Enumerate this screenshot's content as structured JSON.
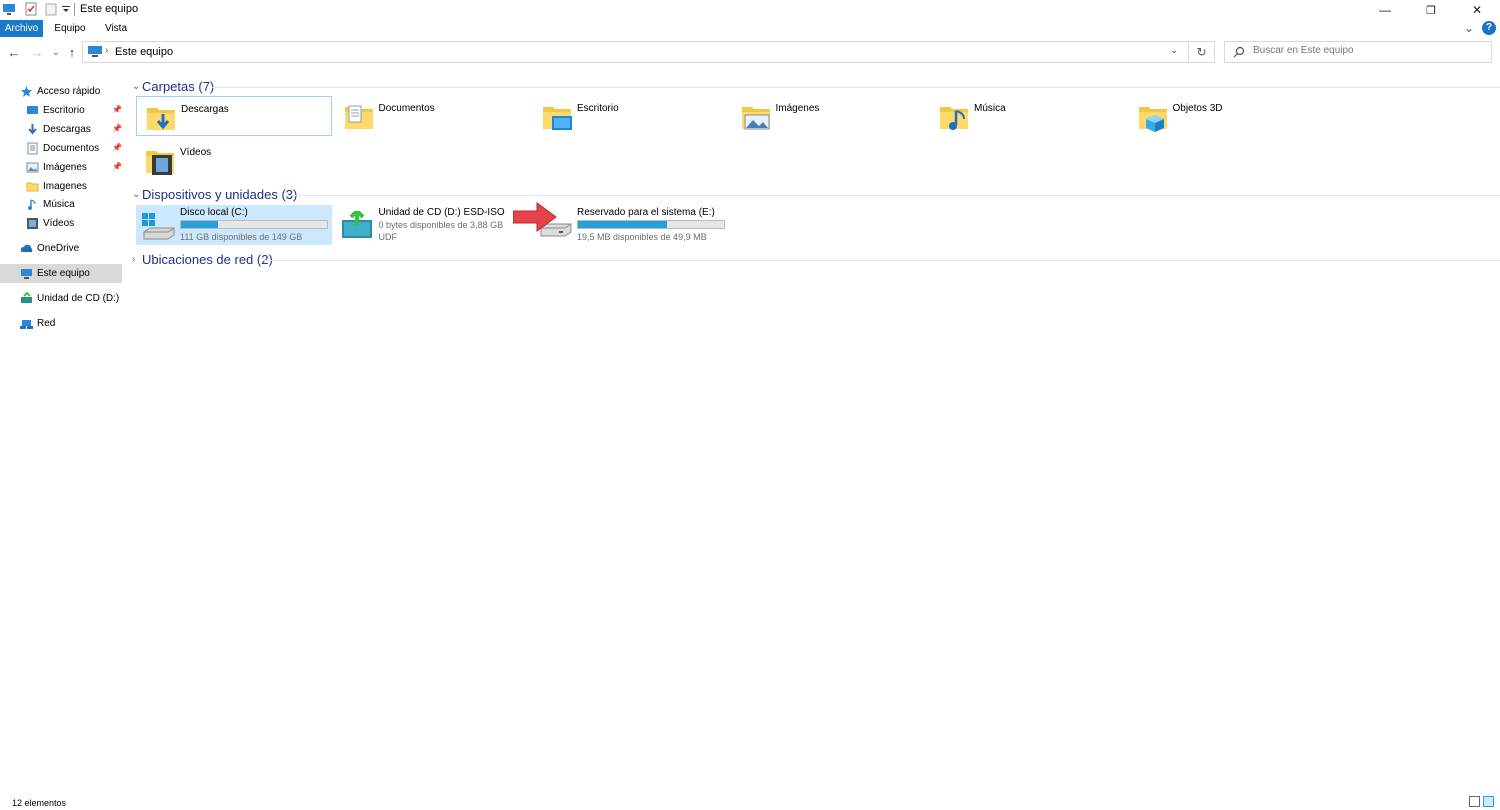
{
  "window": {
    "title": "Este equipo",
    "minimize_glyph": "—",
    "maximize_glyph": "❐",
    "close_glyph": "✕"
  },
  "ribbon": {
    "tabs": [
      "Archivo",
      "Equipo",
      "Vista"
    ],
    "expand_glyph": "⌄",
    "help_glyph": "?"
  },
  "nav": {
    "back_glyph": "←",
    "forward_glyph": "→",
    "recent_glyph": "⌄",
    "up_glyph": "↑",
    "breadcrumb": "Este equipo",
    "breadcrumb_chevron": "›",
    "dropdown_glyph": "⌄",
    "refresh_glyph": "↻"
  },
  "search": {
    "placeholder": "Buscar en Este equipo"
  },
  "sidebar": {
    "items": [
      {
        "label": "Acceso rápido",
        "icon": "star-icon",
        "pinned": false,
        "indent": 1
      },
      {
        "label": "Escritorio",
        "icon": "desktop-icon",
        "pinned": true,
        "indent": 2
      },
      {
        "label": "Descargas",
        "icon": "download-icon",
        "pinned": true,
        "indent": 2
      },
      {
        "label": "Documentos",
        "icon": "document-icon",
        "pinned": true,
        "indent": 2
      },
      {
        "label": "Imágenes",
        "icon": "pictures-icon",
        "pinned": true,
        "indent": 2
      },
      {
        "label": "Imagenes",
        "icon": "folder-icon",
        "pinned": false,
        "indent": 2
      },
      {
        "label": "Música",
        "icon": "music-icon",
        "pinned": false,
        "indent": 2
      },
      {
        "label": "Vídeos",
        "icon": "video-icon",
        "pinned": false,
        "indent": 2
      },
      {
        "label": "OneDrive",
        "icon": "cloud-icon",
        "pinned": false,
        "indent": 1
      },
      {
        "label": "Este equipo",
        "icon": "computer-icon",
        "pinned": false,
        "indent": 1,
        "selected": true
      },
      {
        "label": "Unidad de CD (D:) ES",
        "icon": "cd-drive-icon",
        "pinned": false,
        "indent": 1
      },
      {
        "label": "Red",
        "icon": "network-icon",
        "pinned": false,
        "indent": 1
      }
    ]
  },
  "groups": {
    "folders": {
      "title": "Carpetas (7)",
      "expand_glyph": "⌄"
    },
    "devices": {
      "title": "Dispositivos y unidades (3)",
      "expand_glyph": "⌄"
    },
    "network": {
      "title": "Ubicaciones de red (2)",
      "expand_glyph": "›"
    }
  },
  "folders": [
    {
      "label": "Descargas",
      "icon": "downloads-folder-icon",
      "selected": true
    },
    {
      "label": "Documentos",
      "icon": "documents-folder-icon"
    },
    {
      "label": "Escritorio",
      "icon": "desktop-folder-icon"
    },
    {
      "label": "Imágenes",
      "icon": "pictures-folder-icon"
    },
    {
      "label": "Música",
      "icon": "music-folder-icon"
    },
    {
      "label": "Objetos 3D",
      "icon": "3d-objects-folder-icon"
    },
    {
      "label": "Vídeos",
      "icon": "videos-folder-icon"
    }
  ],
  "drives": [
    {
      "name": "Disco local (C:)",
      "info": "111 GB disponibles de 149 GB",
      "used_fraction": 0.255,
      "icon": "windows-drive-icon",
      "selected": true
    },
    {
      "name": "Unidad de CD (D:) ESD-ISO",
      "info": "0 bytes disponibles de 3,88 GB",
      "info2": "UDF",
      "icon": "cd-drive-icon"
    },
    {
      "name": "Reservado para el sistema (E:)",
      "info": "19,5 MB disponibles de 49,9 MB",
      "used_fraction": 0.61,
      "icon": "hard-drive-icon"
    }
  ],
  "status": {
    "count": "12 elementos"
  },
  "colors": {
    "accent": "#1979ca",
    "progress": "#26a0da",
    "selection": "#cce8ff",
    "group_title": "#1e3287",
    "annotation_arrow": "#e8414a"
  }
}
